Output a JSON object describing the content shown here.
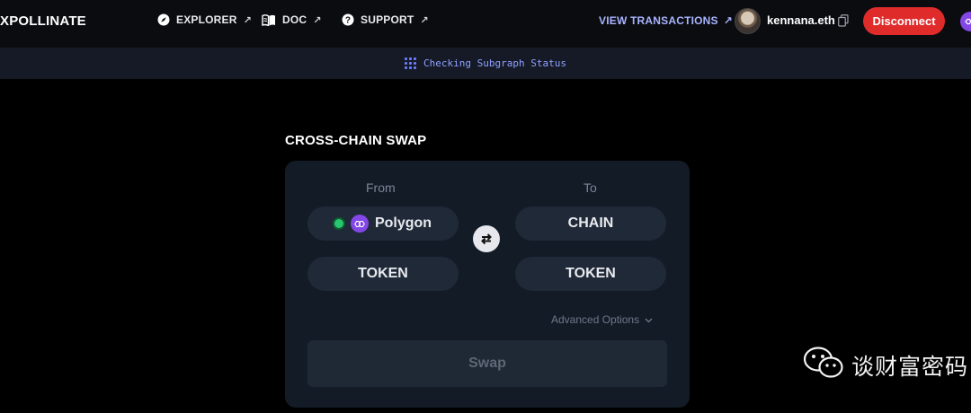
{
  "header": {
    "brand": "XPOLLINATE",
    "nav": [
      {
        "label": "EXPLORER",
        "icon": "compass-icon",
        "ext": "↗"
      },
      {
        "label": "DOC",
        "icon": "book-icon",
        "ext": "↗"
      },
      {
        "label": "SUPPORT",
        "icon": "question-icon",
        "ext": "↗"
      }
    ],
    "view_transactions": "VIEW TRANSACTIONS",
    "view_transactions_ext": "↗",
    "account": "kennana.eth",
    "disconnect": "Disconnect"
  },
  "status": {
    "text": "Checking Subgraph Status"
  },
  "swap": {
    "title": "CROSS-CHAIN SWAP",
    "from_label": "From",
    "to_label": "To",
    "from_chain": "Polygon",
    "to_chain": "CHAIN",
    "from_token": "TOKEN",
    "to_token": "TOKEN",
    "advanced_options": "Advanced Options",
    "swap_button": "Swap"
  },
  "watermark": {
    "text": "谈财富密码"
  },
  "colors": {
    "accent": "#a9b4ff",
    "disconnect": "#e02b2b",
    "polygon": "#8247e5",
    "network_ok": "#28c76f",
    "card": "#131b27",
    "pill": "#1f2937"
  }
}
